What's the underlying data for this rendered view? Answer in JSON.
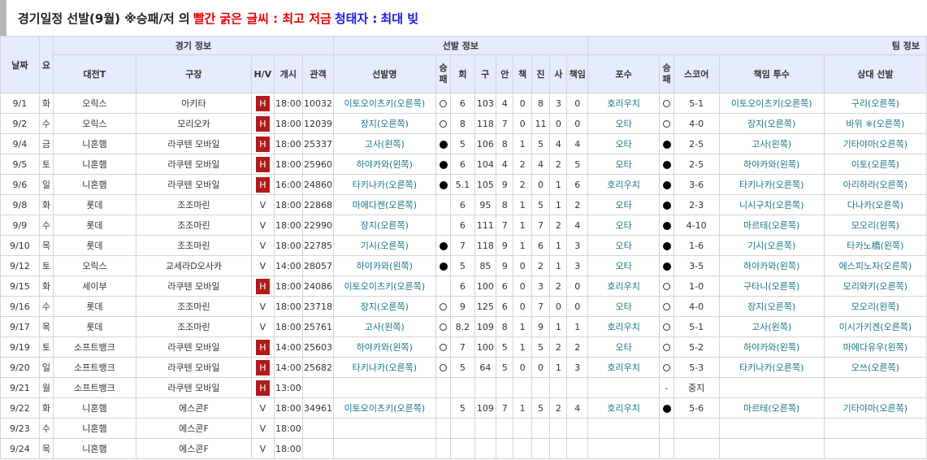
{
  "title": {
    "main": "경기일정 선발(9월) ※승패/저 의",
    "red": "빨간 굵은 글씨 : 최고 저금",
    "blue": "청태자 :",
    "dark": "최대 빚"
  },
  "header": {
    "groups": {
      "date": "날짜",
      "dow": "요",
      "game": "경기 정보",
      "starter": "선발 정보",
      "team": "팀 정보"
    },
    "columns": {
      "opp": "대전T",
      "stadium": "구장",
      "hv": "H/V",
      "start": "개시",
      "att": "관객",
      "pitcher": "선발명",
      "wl": "승패",
      "inn": "회",
      "pitches": "구",
      "hits": "안",
      "er": "책",
      "k": "진",
      "bb": "사",
      "resp": "책임",
      "catcher": "포수",
      "team_wl": "승패",
      "score": "스코어",
      "resp_pitcher": "책임 투수",
      "opp_starter": "상대 선발"
    }
  },
  "rows": [
    {
      "date": "9/1",
      "dow": "화",
      "opp": "오릭스",
      "stadium": "아키타",
      "hv": "H",
      "start": "18:00",
      "att": "10032",
      "pitcher": "이토오이츠키(오른쪽)",
      "wl": "open",
      "inn": "6",
      "pitches": "103",
      "hits": "4",
      "er": "0",
      "k": "8",
      "bb": "3",
      "resp": "0",
      "catcher": "호리우치",
      "team_wl": "open",
      "score": "5-1",
      "resp_pitcher": "이토오이츠키(오른쪽)",
      "opp_starter": "구리(오른쪽)"
    },
    {
      "date": "9/2",
      "dow": "수",
      "opp": "오릭스",
      "stadium": "모리오카",
      "hv": "H",
      "start": "18:00",
      "att": "12039",
      "pitcher": "장지(오른쪽)",
      "wl": "open",
      "inn": "8",
      "pitches": "118",
      "hits": "7",
      "er": "0",
      "k": "11",
      "bb": "0",
      "resp": "0",
      "catcher": "오타",
      "team_wl": "open",
      "score": "4-0",
      "resp_pitcher": "장지(오른쪽)",
      "opp_starter": "바위 ※(오른쪽)"
    },
    {
      "date": "9/4",
      "dow": "금",
      "opp": "니혼햄",
      "stadium": "라쿠텐 모바일",
      "hv": "H",
      "start": "18:00",
      "att": "25337",
      "pitcher": "고사(왼쪽)",
      "wl": "fill",
      "inn": "5",
      "pitches": "106",
      "hits": "8",
      "er": "1",
      "k": "5",
      "bb": "4",
      "resp": "4",
      "catcher": "오타",
      "team_wl": "fill",
      "score": "2-5",
      "resp_pitcher": "고사(왼쪽)",
      "opp_starter": "기타야마(오른쪽)"
    },
    {
      "date": "9/5",
      "dow": "토",
      "opp": "니혼햄",
      "stadium": "라쿠텐 모바일",
      "hv": "H",
      "start": "18:00",
      "att": "25960",
      "pitcher": "하야카와(왼쪽)",
      "wl": "fill",
      "inn": "6",
      "pitches": "104",
      "hits": "4",
      "er": "2",
      "k": "4",
      "bb": "2",
      "resp": "5",
      "catcher": "오타",
      "team_wl": "fill",
      "score": "2-5",
      "resp_pitcher": "하야카와(왼쪽)",
      "opp_starter": "이토(오른쪽)"
    },
    {
      "date": "9/6",
      "dow": "일",
      "opp": "니혼햄",
      "stadium": "라쿠텐 모바일",
      "hv": "H",
      "start": "16:00",
      "att": "24860",
      "pitcher": "타키나카(오른쪽)",
      "wl": "fill",
      "inn": "5.1",
      "pitches": "105",
      "hits": "9",
      "er": "2",
      "k": "0",
      "bb": "1",
      "resp": "6",
      "catcher": "호리우치",
      "team_wl": "fill",
      "score": "3-6",
      "resp_pitcher": "타키나카(오른쪽)",
      "opp_starter": "아리하라(오른쪽)"
    },
    {
      "date": "9/8",
      "dow": "화",
      "opp": "롯데",
      "stadium": "조조마린",
      "hv": "V",
      "start": "18:00",
      "att": "22868",
      "pitcher": "마에다켄(오른쪽)",
      "wl": "",
      "inn": "6",
      "pitches": "95",
      "hits": "8",
      "er": "1",
      "k": "5",
      "bb": "1",
      "resp": "2",
      "catcher": "오타",
      "team_wl": "fill",
      "score": "2-3",
      "resp_pitcher": "니시구치(오른쪽)",
      "opp_starter": "다나카(오른쪽)"
    },
    {
      "date": "9/9",
      "dow": "수",
      "opp": "롯데",
      "stadium": "조조마린",
      "hv": "V",
      "start": "18:00",
      "att": "22990",
      "pitcher": "장지(오른쪽)",
      "wl": "",
      "inn": "6",
      "pitches": "111",
      "hits": "7",
      "er": "1",
      "k": "7",
      "bb": "2",
      "resp": "4",
      "catcher": "오타",
      "team_wl": "fill",
      "score": "4-10",
      "resp_pitcher": "마르테(오른쪽)",
      "opp_starter": "모오리(왼쪽)"
    },
    {
      "date": "9/10",
      "dow": "목",
      "opp": "롯데",
      "stadium": "조조마린",
      "hv": "V",
      "start": "18:00",
      "att": "22785",
      "pitcher": "기시(오른쪽)",
      "wl": "fill",
      "inn": "7",
      "pitches": "118",
      "hits": "9",
      "er": "1",
      "k": "6",
      "bb": "1",
      "resp": "3",
      "catcher": "오타",
      "team_wl": "fill",
      "score": "1-6",
      "resp_pitcher": "기시(오른쪽)",
      "opp_starter": "타카노橋(왼쪽)"
    },
    {
      "date": "9/12",
      "dow": "토",
      "opp": "오릭스",
      "stadium": "교세라D오사카",
      "hv": "V",
      "start": "14:00",
      "att": "28057",
      "pitcher": "하야카와(왼쪽)",
      "wl": "fill",
      "inn": "5",
      "pitches": "85",
      "hits": "9",
      "er": "0",
      "k": "2",
      "bb": "1",
      "resp": "3",
      "catcher": "오타",
      "team_wl": "fill",
      "score": "3-5",
      "resp_pitcher": "하야카와(왼쪽)",
      "opp_starter": "에스피노자(오른쪽)"
    },
    {
      "date": "9/15",
      "dow": "화",
      "opp": "세이부",
      "stadium": "라쿠텐 모바일",
      "hv": "H",
      "start": "18:00",
      "att": "24086",
      "pitcher": "이토오이츠키(오른쪽)",
      "wl": "",
      "inn": "6",
      "pitches": "100",
      "hits": "6",
      "er": "0",
      "k": "3",
      "bb": "2",
      "resp": "0",
      "catcher": "호리우치",
      "team_wl": "open",
      "score": "1-0",
      "resp_pitcher": "구타니(오른쪽)",
      "opp_starter": "모리와키(오른쪽)"
    },
    {
      "date": "9/16",
      "dow": "수",
      "opp": "롯데",
      "stadium": "조조마린",
      "hv": "V",
      "start": "18:00",
      "att": "23718",
      "pitcher": "장지(오른쪽)",
      "wl": "open",
      "inn": "9",
      "pitches": "125",
      "hits": "6",
      "er": "0",
      "k": "7",
      "bb": "0",
      "resp": "0",
      "catcher": "오타",
      "team_wl": "open",
      "score": "4-0",
      "resp_pitcher": "장지(오른쪽)",
      "opp_starter": "모오리(왼쪽)"
    },
    {
      "date": "9/17",
      "dow": "목",
      "opp": "롯데",
      "stadium": "조조마린",
      "hv": "V",
      "start": "18:00",
      "att": "25761",
      "pitcher": "고사(왼쪽)",
      "wl": "open",
      "inn": "8.2",
      "pitches": "109",
      "hits": "8",
      "er": "1",
      "k": "9",
      "bb": "1",
      "resp": "1",
      "catcher": "호리우치",
      "team_wl": "open",
      "score": "5-1",
      "resp_pitcher": "고사(왼쪽)",
      "opp_starter": "이시가키겐(오른쪽)"
    },
    {
      "date": "9/19",
      "dow": "토",
      "opp": "소프트뱅크",
      "stadium": "라쿠텐 모바일",
      "hv": "H",
      "start": "14:00",
      "att": "25603",
      "pitcher": "하야카와(왼쪽)",
      "wl": "open",
      "inn": "7",
      "pitches": "100",
      "hits": "5",
      "er": "1",
      "k": "5",
      "bb": "2",
      "resp": "2",
      "catcher": "오타",
      "team_wl": "open",
      "score": "5-2",
      "resp_pitcher": "하야카와(왼쪽)",
      "opp_starter": "마에다유우(왼쪽)"
    },
    {
      "date": "9/20",
      "dow": "일",
      "opp": "소프트뱅크",
      "stadium": "라쿠텐 모바일",
      "hv": "H",
      "start": "14:00",
      "att": "25682",
      "pitcher": "타키나카(오른쪽)",
      "wl": "open",
      "inn": "5",
      "pitches": "64",
      "hits": "5",
      "er": "0",
      "k": "0",
      "bb": "1",
      "resp": "3",
      "catcher": "호리우치",
      "team_wl": "open",
      "score": "5-3",
      "resp_pitcher": "타키나카(오른쪽)",
      "opp_starter": "오쓰(오른쪽)"
    },
    {
      "date": "9/21",
      "dow": "월",
      "opp": "소프트뱅크",
      "stadium": "라쿠텐 모바일",
      "hv": "H",
      "start": "13:00",
      "att": "",
      "pitcher": "",
      "wl": "",
      "inn": "",
      "pitches": "",
      "hits": "",
      "er": "",
      "k": "",
      "bb": "",
      "resp": "",
      "catcher": "",
      "team_wl": "dash",
      "score": "중지",
      "resp_pitcher": "",
      "opp_starter": ""
    },
    {
      "date": "9/22",
      "dow": "화",
      "opp": "니혼햄",
      "stadium": "에스콘F",
      "hv": "V",
      "start": "18:00",
      "att": "34961",
      "pitcher": "이토오이츠키(오른쪽)",
      "wl": "",
      "inn": "5",
      "pitches": "109",
      "hits": "7",
      "er": "1",
      "k": "5",
      "bb": "2",
      "resp": "4",
      "catcher": "호리우치",
      "team_wl": "fill",
      "score": "5-6",
      "resp_pitcher": "마르테(오른쪽)",
      "opp_starter": "기타야마(오른쪽)"
    },
    {
      "date": "9/23",
      "dow": "수",
      "opp": "니혼햄",
      "stadium": "에스콘F",
      "hv": "V",
      "start": "18:00",
      "att": "",
      "pitcher": "",
      "wl": "",
      "inn": "",
      "pitches": "",
      "hits": "",
      "er": "",
      "k": "",
      "bb": "",
      "resp": "",
      "catcher": "",
      "team_wl": "",
      "score": "",
      "resp_pitcher": "",
      "opp_starter": ""
    },
    {
      "date": "9/24",
      "dow": "목",
      "opp": "니혼햄",
      "stadium": "에스콘F",
      "hv": "V",
      "start": "18:00",
      "att": "",
      "pitcher": "",
      "wl": "",
      "inn": "",
      "pitches": "",
      "hits": "",
      "er": "",
      "k": "",
      "bb": "",
      "resp": "",
      "catcher": "",
      "team_wl": "",
      "score": "",
      "resp_pitcher": "",
      "opp_starter": ""
    }
  ],
  "colors": {
    "header_bg": "#e6ebff",
    "home_badge": "#b21a1a",
    "link": "#1a7585",
    "red": "#e60000",
    "blue": "#1a1ae6"
  },
  "icons": {
    "win": "open-circle-icon",
    "loss": "filled-circle-icon",
    "home": "home-badge-icon"
  }
}
